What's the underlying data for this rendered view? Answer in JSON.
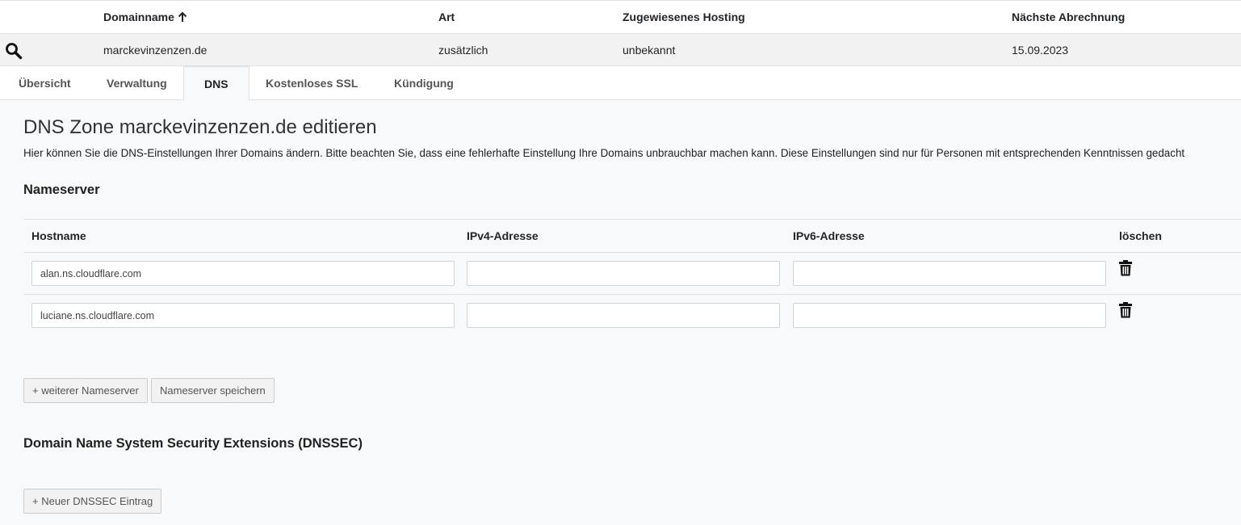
{
  "domain_table": {
    "headers": {
      "domainname": "Domainname",
      "art": "Art",
      "hosting": "Zugewiesenes Hosting",
      "abrechnung": "Nächste Abrechnung"
    },
    "row": {
      "domainname": "marckevinzenzen.de",
      "art": "zusätzlich",
      "hosting": "unbekannt",
      "abrechnung": "15.09.2023"
    },
    "sort_icon": "arrow-up-icon",
    "search_icon": "search-icon"
  },
  "tabs": [
    {
      "label": "Übersicht",
      "active": false
    },
    {
      "label": "Verwaltung",
      "active": false
    },
    {
      "label": "DNS",
      "active": true
    },
    {
      "label": "Kostenloses SSL",
      "active": false
    },
    {
      "label": "Kündigung",
      "active": false
    }
  ],
  "dns": {
    "title": "DNS Zone marckevinzenzen.de editieren",
    "description": "Hier können Sie die DNS-Einstellungen Ihrer Domains ändern. Bitte beachten Sie, dass eine fehlerhafte Einstellung Ihre Domains unbrauchbar machen kann. Diese Einstellungen sind nur für Personen mit entsprechenden Kenntnissen gedacht"
  },
  "nameserver": {
    "section_title": "Nameserver",
    "headers": {
      "hostname": "Hostname",
      "ipv4": "IPv4-Adresse",
      "ipv6": "IPv6-Adresse",
      "delete": "löschen"
    },
    "rows": [
      {
        "hostname": "alan.ns.cloudflare.com",
        "ipv4": "",
        "ipv6": ""
      },
      {
        "hostname": "luciane.ns.cloudflare.com",
        "ipv4": "",
        "ipv6": ""
      }
    ],
    "add_button": "+ weiterer Nameserver",
    "save_button": "Nameserver speichern",
    "delete_icon": "trash-icon"
  },
  "dnssec": {
    "section_title": "Domain Name System Security Extensions (DNSSEC)",
    "add_button": "+ Neuer DNSSEC Eintrag"
  }
}
